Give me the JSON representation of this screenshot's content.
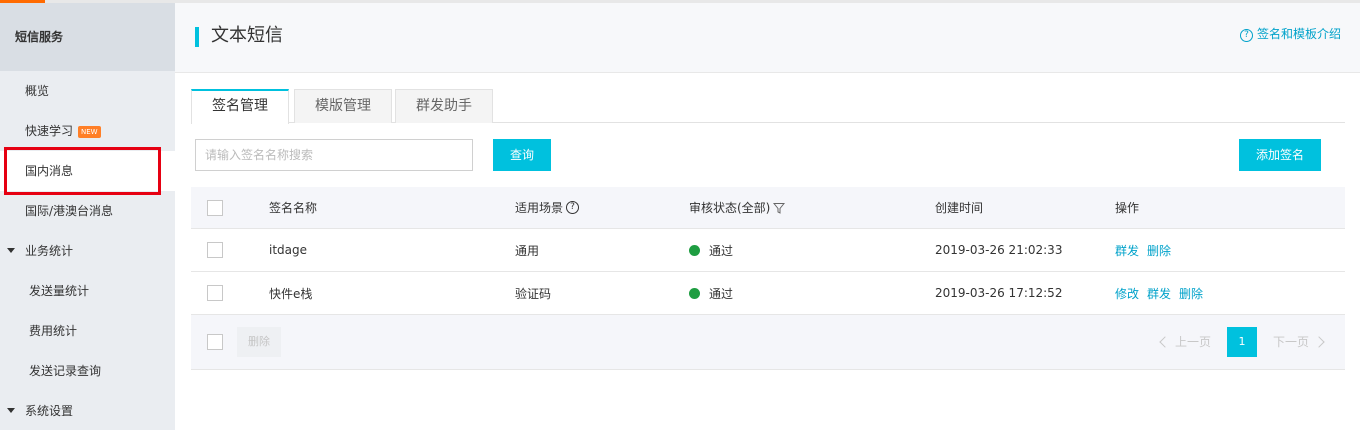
{
  "sidebar": {
    "title": "短信服务",
    "items": [
      {
        "label": "概览"
      },
      {
        "label": "快速学习",
        "badge": "NEW"
      },
      {
        "label": "国内消息"
      },
      {
        "label": "国际/港澳台消息"
      },
      {
        "label": "业务统计"
      },
      {
        "label": "发送量统计"
      },
      {
        "label": "费用统计"
      },
      {
        "label": "发送记录查询"
      },
      {
        "label": "系统设置"
      }
    ]
  },
  "header": {
    "title": "文本短信",
    "help_icon": "?",
    "help_link": "签名和模板介绍"
  },
  "tabs": [
    {
      "label": "签名管理",
      "active": true
    },
    {
      "label": "模版管理",
      "active": false
    },
    {
      "label": "群发助手",
      "active": false
    }
  ],
  "search": {
    "placeholder": "请输入签名名称搜索",
    "button": "查询"
  },
  "add_button": "添加签名",
  "table": {
    "columns": {
      "name": "签名名称",
      "scene": "适用场景",
      "scene_help": "?",
      "status": "审核状态(全部)",
      "created": "创建时间",
      "actions": "操作"
    },
    "rows": [
      {
        "name": "itdage",
        "scene": "通用",
        "status": "通过",
        "created": "2019-03-26 21:02:33",
        "actions": [
          "群发",
          "删除"
        ]
      },
      {
        "name": "快件e栈",
        "scene": "验证码",
        "status": "通过",
        "created": "2019-03-26 17:12:52",
        "actions": [
          "修改",
          "群发",
          "删除"
        ]
      }
    ]
  },
  "footer": {
    "delete_button": "删除",
    "prev": "上一页",
    "page": "1",
    "next": "下一页"
  },
  "colors": {
    "accent": "#00c1de",
    "link": "#00a2ca",
    "success": "#1e9d41",
    "highlight_box": "#e60012"
  }
}
